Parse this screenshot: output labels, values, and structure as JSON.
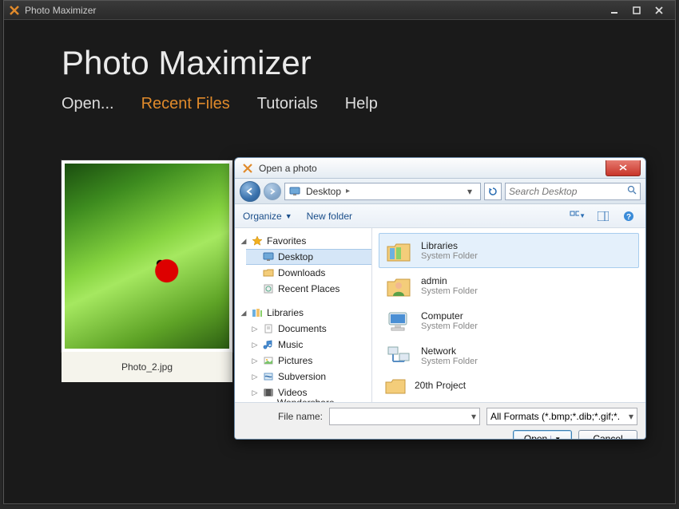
{
  "window": {
    "title": "Photo Maximizer"
  },
  "app": {
    "title": "Photo Maximizer",
    "menu": {
      "open": "Open...",
      "recent": "Recent Files",
      "tutorials": "Tutorials",
      "help": "Help"
    },
    "thumbnail": {
      "caption": "Photo_2.jpg"
    }
  },
  "dialog": {
    "title": "Open a photo",
    "breadcrumb": {
      "location": "Desktop",
      "arrow": "▸"
    },
    "search_placeholder": "Search Desktop",
    "toolbar": {
      "organize": "Organize",
      "newfolder": "New folder"
    },
    "tree": {
      "favorites": "Favorites",
      "desktop": "Desktop",
      "downloads": "Downloads",
      "recentplaces": "Recent Places",
      "libraries": "Libraries",
      "documents": "Documents",
      "music": "Music",
      "pictures": "Pictures",
      "subversion": "Subversion",
      "videos": "Videos",
      "wondershare": "Wondershare AllMyTu"
    },
    "files": {
      "libraries": {
        "name": "Libraries",
        "type": "System Folder"
      },
      "admin": {
        "name": "admin",
        "type": "System Folder"
      },
      "computer": {
        "name": "Computer",
        "type": "System Folder"
      },
      "network": {
        "name": "Network",
        "type": "System Folder"
      },
      "project": {
        "name": "20th Project",
        "type": ""
      }
    },
    "footer": {
      "filename_label": "File name:",
      "filter": "All Formats (*.bmp;*.dib;*.gif;*.",
      "open": "Open",
      "cancel": "Cancel"
    }
  }
}
